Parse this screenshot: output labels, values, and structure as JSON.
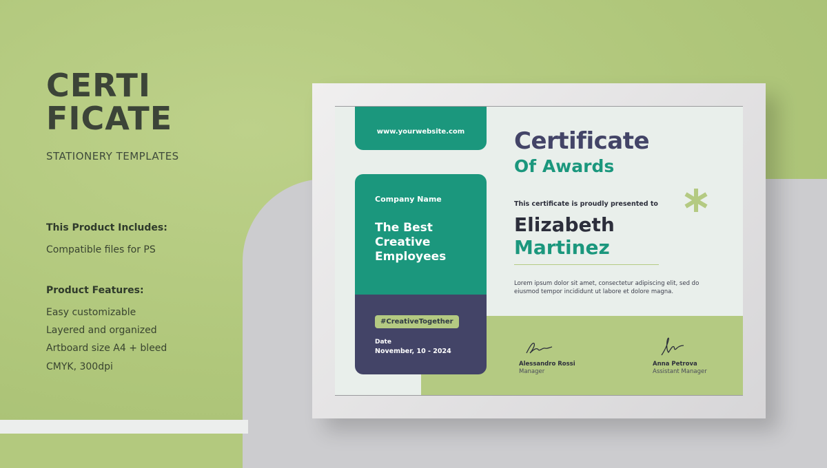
{
  "promo": {
    "title_line1": "CERTI",
    "title_line2": "FICATE",
    "subtitle": "STATIONERY TEMPLATES",
    "includes_heading": "This Product Includes:",
    "includes_items": [
      "Compatible files for PS"
    ],
    "features_heading": "Product Features:",
    "features_items": [
      "Easy customizable",
      "Layered and organized",
      "Artboard size A4 + bleed",
      "CMYK, 300dpi"
    ]
  },
  "certificate": {
    "website": "www.yourwebsite.com",
    "company_name": "Company Name",
    "best_title": "The Best Creative Employees",
    "hashtag": "#CreativeTogether",
    "date_label": "Date",
    "date_value": "November, 10 - 2024",
    "title": "Certificate",
    "subtitle": "Of Awards",
    "presented_text": "This certificate is proudly presented to",
    "first_name": "Elizabeth",
    "last_name": "Martinez",
    "description": "Lorem ipsum dolor sit amet, consectetur adipiscing elit, sed do eiusmod tempor incididunt ut labore et dolore magna.",
    "signatures": [
      {
        "name": "Alessandro Rossi",
        "role": "Manager"
      },
      {
        "name": "Anna Petrova",
        "role": "Assistant Manager"
      }
    ]
  },
  "colors": {
    "background_green": "#b3c97e",
    "teal": "#1b977d",
    "navy": "#434467",
    "light_green": "#b4ca82"
  },
  "icons": [
    "asterisk-icon",
    "signature-icon"
  ]
}
